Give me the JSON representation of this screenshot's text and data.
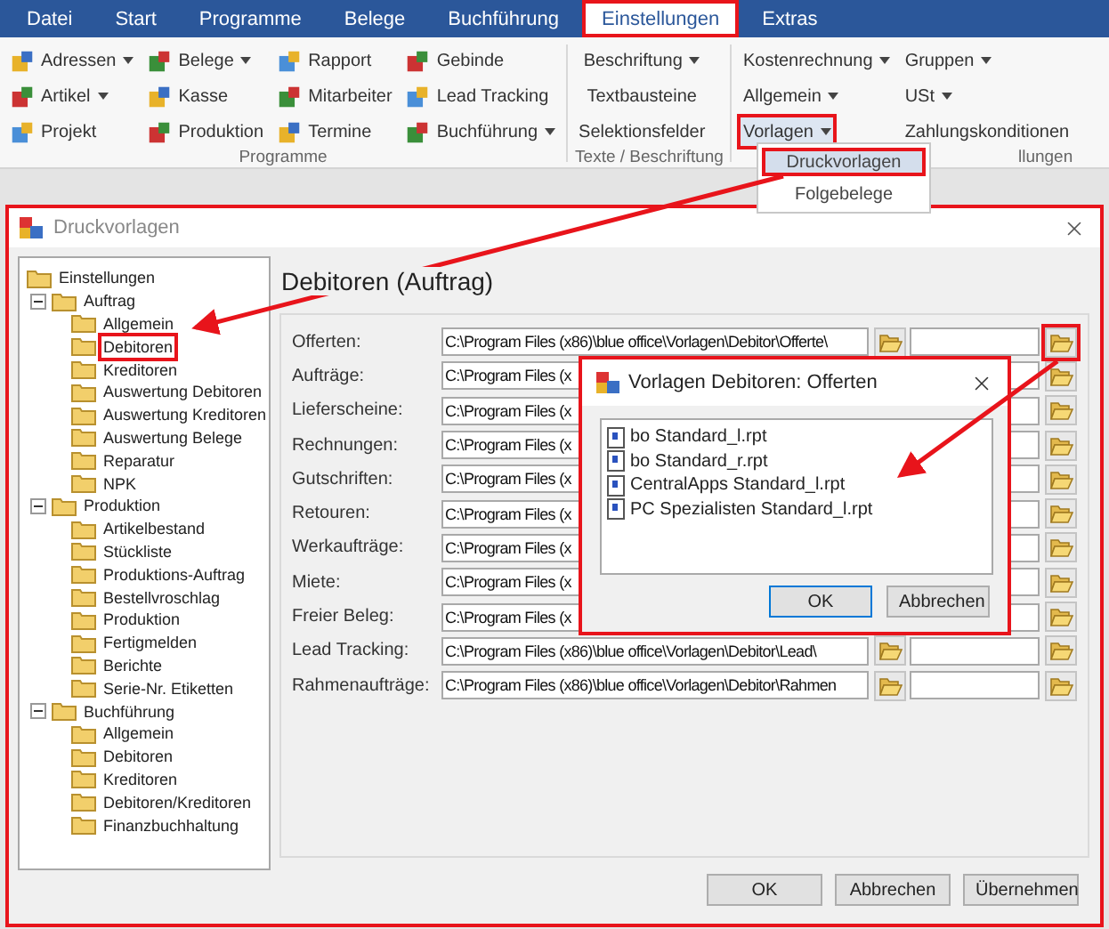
{
  "menu_tabs": [
    {
      "label": "Datei",
      "selected": false,
      "highlighted": false
    },
    {
      "label": "Start",
      "selected": false,
      "highlighted": false
    },
    {
      "label": "Programme",
      "selected": false,
      "highlighted": false
    },
    {
      "label": "Belege",
      "selected": false,
      "highlighted": false
    },
    {
      "label": "Buchführung",
      "selected": false,
      "highlighted": false
    },
    {
      "label": "Einstellungen",
      "selected": true,
      "highlighted": true
    },
    {
      "label": "Extras",
      "selected": false,
      "highlighted": false
    }
  ],
  "ribbon": {
    "groups": [
      {
        "label": "Programme",
        "kind": "icons",
        "columns": [
          [
            {
              "label": "Adressen",
              "dropdown": true
            },
            {
              "label": "Artikel",
              "dropdown": true
            },
            {
              "label": "Projekt",
              "dropdown": false
            }
          ],
          [
            {
              "label": "Belege",
              "dropdown": true
            },
            {
              "label": "Kasse",
              "dropdown": false
            },
            {
              "label": "Produktion",
              "dropdown": false
            }
          ],
          [
            {
              "label": "Rapport",
              "dropdown": false
            },
            {
              "label": "Mitarbeiter",
              "dropdown": false
            },
            {
              "label": "Termine",
              "dropdown": false
            }
          ],
          [
            {
              "label": "Gebinde",
              "dropdown": false
            },
            {
              "label": "Lead Tracking",
              "dropdown": false
            },
            {
              "label": "Buchführung",
              "dropdown": true
            }
          ]
        ]
      },
      {
        "label": "Texte / Beschriftung",
        "kind": "text",
        "columns": [
          [
            {
              "label": "Beschriftung",
              "dropdown": true
            },
            {
              "label": "Textbausteine",
              "dropdown": false
            },
            {
              "label": "Selektionsfelder",
              "dropdown": false
            }
          ]
        ]
      },
      {
        "label": "llungen",
        "kind": "text",
        "columns": [
          [
            {
              "label": "Kostenrechnung",
              "dropdown": true,
              "highlighted": false
            },
            {
              "label": "Allgemein",
              "dropdown": true,
              "highlighted": false
            },
            {
              "label": "Vorlagen",
              "dropdown": true,
              "highlighted": true
            }
          ],
          [
            {
              "label": "Gruppen",
              "dropdown": true,
              "highlighted": false
            },
            {
              "label": "USt",
              "dropdown": true,
              "highlighted": false
            },
            {
              "label": "Zahlungskonditionen",
              "dropdown": false,
              "highlighted": false
            }
          ]
        ]
      }
    ]
  },
  "dropdown_menu": {
    "items": [
      {
        "label": "Druckvorlagen",
        "selected": true,
        "highlighted": true
      },
      {
        "label": "Folgebelege",
        "selected": false,
        "highlighted": false
      }
    ]
  },
  "dialog": {
    "title": "Druckvorlagen",
    "highlighted": true,
    "tree": [
      {
        "label": "Einstellungen",
        "children": [
          {
            "label": "Auftrag",
            "expanded": true,
            "children": [
              {
                "label": "Allgemein",
                "highlighted": false
              },
              {
                "label": "Debitoren",
                "highlighted": true
              },
              {
                "label": "Kreditoren",
                "highlighted": false
              },
              {
                "label": "Auswertung Debitoren",
                "highlighted": false
              },
              {
                "label": "Auswertung Kreditoren",
                "highlighted": false
              },
              {
                "label": "Auswertung Belege",
                "highlighted": false
              },
              {
                "label": "Reparatur",
                "highlighted": false
              },
              {
                "label": "NPK",
                "highlighted": false
              }
            ]
          },
          {
            "label": "Produktion",
            "expanded": true,
            "children": [
              {
                "label": "Artikelbestand",
                "highlighted": false
              },
              {
                "label": "Stückliste",
                "highlighted": false
              },
              {
                "label": "Produktions-Auftrag",
                "highlighted": false
              },
              {
                "label": "Bestellvroschlag",
                "highlighted": false
              },
              {
                "label": "Produktion",
                "highlighted": false
              },
              {
                "label": "Fertigmelden",
                "highlighted": false
              },
              {
                "label": "Berichte",
                "highlighted": false
              },
              {
                "label": "Serie-Nr. Etiketten",
                "highlighted": false
              }
            ]
          },
          {
            "label": "Buchführung",
            "expanded": true,
            "children": [
              {
                "label": "Allgemein",
                "highlighted": false
              },
              {
                "label": "Debitoren",
                "highlighted": false
              },
              {
                "label": "Kreditoren",
                "highlighted": false
              },
              {
                "label": "Debitoren/Kreditoren",
                "highlighted": false
              },
              {
                "label": "Finanzbuchhaltung",
                "highlighted": false
              }
            ]
          }
        ]
      }
    ],
    "heading": "Debitoren (Auftrag)",
    "rows": [
      {
        "kind": "full",
        "label": "Offerten:",
        "path": "C:\\Program Files (x86)\\blue office\\Vorlagen\\Debitor\\Offerte\\",
        "browse_highlighted": true
      },
      {
        "kind": "partial",
        "label": "Aufträge:",
        "path": "C:\\Program Files (x",
        "browse_highlighted": false
      },
      {
        "kind": "partial",
        "label": "Lieferscheine:",
        "path": "C:\\Program Files (x",
        "browse_highlighted": false
      },
      {
        "kind": "partial",
        "label": "Rechnungen:",
        "path": "C:\\Program Files (x",
        "browse_highlighted": false
      },
      {
        "kind": "partial",
        "label": "Gutschriften:",
        "path": "C:\\Program Files (x",
        "browse_highlighted": false
      },
      {
        "kind": "partial",
        "label": "Retouren:",
        "path": "C:\\Program Files (x",
        "browse_highlighted": false
      },
      {
        "kind": "partial",
        "label": "Werkaufträge:",
        "path": "C:\\Program Files (x",
        "browse_highlighted": false
      },
      {
        "kind": "partial",
        "label": "Miete:",
        "path": "C:\\Program Files (x",
        "browse_highlighted": false
      },
      {
        "kind": "partial",
        "label": "Freier Beleg:",
        "path": "C:\\Program Files (x",
        "browse_highlighted": false
      },
      {
        "kind": "full",
        "label": "Lead Tracking:",
        "path": "C:\\Program Files (x86)\\blue office\\Vorlagen\\Debitor\\Lead\\",
        "browse_highlighted": false
      },
      {
        "kind": "full",
        "label": "Rahmenaufträge:",
        "path": "C:\\Program Files (x86)\\blue office\\Vorlagen\\Debitor\\Rahmen",
        "browse_highlighted": false
      }
    ],
    "buttons": [
      "OK",
      "Abbrechen",
      "Übernehmen"
    ]
  },
  "subdialog": {
    "title": "Vorlagen Debitoren: Offerten",
    "highlighted": true,
    "files": [
      "bo Standard_l.rpt",
      "bo Standard_r.rpt",
      "CentralApps Standard_l.rpt",
      "PC Spezialisten Standard_l.rpt"
    ],
    "buttons": [
      {
        "label": "OK",
        "focused": true
      },
      {
        "label": "Abbrechen",
        "focused": false
      }
    ]
  }
}
